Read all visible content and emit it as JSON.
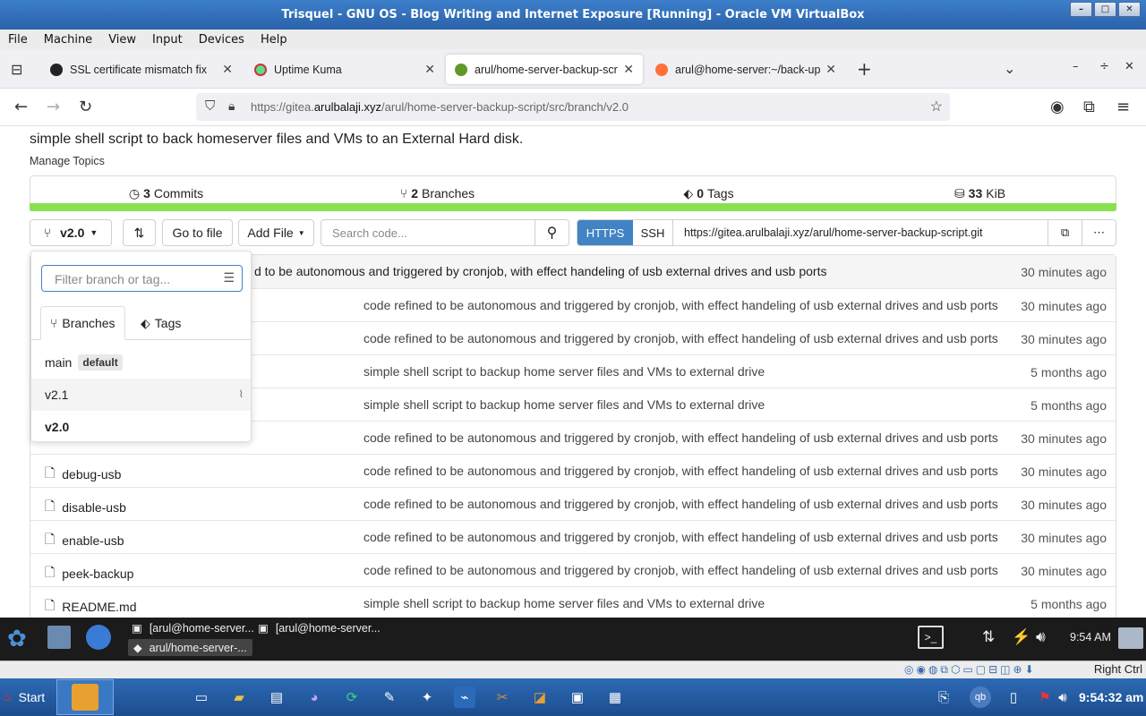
{
  "vbox": {
    "title": "Trisquel - GNU OS - Blog Writing and Internet Exposure [Running] - Oracle VM VirtualBox",
    "menu": [
      "File",
      "Machine",
      "View",
      "Input",
      "Devices",
      "Help"
    ],
    "status_right": "Right Ctrl"
  },
  "browser": {
    "tabs": [
      {
        "label": "SSL certificate mismatch fix",
        "color": "#222222"
      },
      {
        "label": "Uptime Kuma",
        "color": "#5cdd8b"
      },
      {
        "label": "arul/home-server-backup-script",
        "color": "#609926"
      },
      {
        "label": "arul@home-server:~/back-up-sc",
        "color": "#ff7139"
      }
    ],
    "url_prefix": "https://gitea.",
    "url_domain": "arulbalaji.xyz",
    "url_path": "/arul/home-server-backup-script/src/branch/v2.0"
  },
  "repo": {
    "description": "simple shell script to back homeserver files and VMs to an External Hard disk.",
    "manage_topics": "Manage Topics",
    "stats": [
      {
        "count": "3",
        "label": "Commits"
      },
      {
        "count": "2",
        "label": "Branches"
      },
      {
        "count": "0",
        "label": "Tags"
      },
      {
        "count": "33",
        "label": "KiB"
      }
    ],
    "branch": "v2.0",
    "go_to_file": "Go to file",
    "add_file": "Add File",
    "search_placeholder": "Search code...",
    "clone_https": "HTTPS",
    "clone_ssh": "SSH",
    "clone_url": "https://gitea.arulbalaji.xyz/arul/home-server-backup-script.git",
    "latest_commit": {
      "message": "d to be autonomous and triggered by cronjob, with effect handeling of usb external drives and usb ports",
      "time": "30 minutes ago"
    },
    "files": [
      {
        "name": "",
        "message": "code refined to be autonomous and triggered by cronjob, with effect handeling of usb external drives and usb ports",
        "time": "30 minutes ago"
      },
      {
        "name": "",
        "message": "code refined to be autonomous and triggered by cronjob, with effect handeling of usb external drives and usb ports",
        "time": "30 minutes ago"
      },
      {
        "name": "",
        "message": "simple shell script to backup home server files and VMs to external drive",
        "time": "5 months ago"
      },
      {
        "name": "",
        "message": "simple shell script to backup home server files and VMs to external drive",
        "time": "5 months ago"
      },
      {
        "name": "",
        "message": "code refined to be autonomous and triggered by cronjob, with effect handeling of usb external drives and usb ports",
        "time": "30 minutes ago"
      },
      {
        "name": "debug-usb",
        "message": "code refined to be autonomous and triggered by cronjob, with effect handeling of usb external drives and usb ports",
        "time": "30 minutes ago"
      },
      {
        "name": "disable-usb",
        "message": "code refined to be autonomous and triggered by cronjob, with effect handeling of usb external drives and usb ports",
        "time": "30 minutes ago"
      },
      {
        "name": "enable-usb",
        "message": "code refined to be autonomous and triggered by cronjob, with effect handeling of usb external drives and usb ports",
        "time": "30 minutes ago"
      },
      {
        "name": "peek-backup",
        "message": "code refined to be autonomous and triggered by cronjob, with effect handeling of usb external drives and usb ports",
        "time": "30 minutes ago"
      },
      {
        "name": "README.md",
        "message": "simple shell script to backup home server files and VMs to external drive",
        "time": "5 months ago"
      }
    ]
  },
  "dropdown": {
    "filter_placeholder": "Filter branch or tag...",
    "tab_branches": "Branches",
    "tab_tags": "Tags",
    "items": [
      {
        "name": "main",
        "badge": "default"
      },
      {
        "name": "v2.1"
      },
      {
        "name": "v2.0"
      }
    ]
  },
  "guest_panel": {
    "tasks": [
      "[arul@home-server...",
      "[arul@home-server...",
      "arul/home-server-..."
    ],
    "clock": "9:54 AM"
  },
  "host": {
    "start": "Start",
    "clock": "9:54:32 am"
  }
}
